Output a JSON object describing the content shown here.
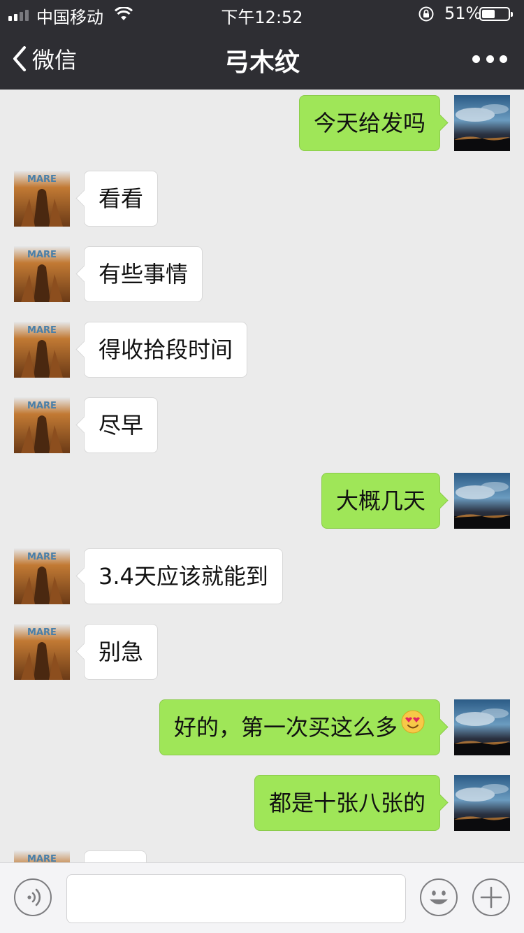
{
  "status_bar": {
    "carrier": "中国移动",
    "time": "下午12:52",
    "battery_percent_label": "51%",
    "battery_level": 0.51,
    "signal_bars": 2,
    "signal_total": 5
  },
  "nav": {
    "back_label": "微信",
    "title": "弓木纹"
  },
  "messages": [
    {
      "side": "right",
      "text": "今天给发吗"
    },
    {
      "side": "left",
      "text": "看看"
    },
    {
      "side": "left",
      "text": "有些事情"
    },
    {
      "side": "left",
      "text": "得收拾段时间"
    },
    {
      "side": "left",
      "text": "尽早"
    },
    {
      "side": "right",
      "text": "大概几天"
    },
    {
      "side": "left",
      "text": "3.4天应该就能到"
    },
    {
      "side": "left",
      "text": "别急"
    },
    {
      "side": "right",
      "text": "好的，第一次买这么多",
      "emoji": "heart-eyes-emoji"
    },
    {
      "side": "right",
      "text": "都是十张八张的"
    },
    {
      "side": "left",
      "text": ""
    }
  ],
  "input_bar": {
    "value": "",
    "voice_icon": "voice-icon",
    "emoji_icon": "smiley-icon",
    "plus_icon": "plus-icon"
  },
  "colors": {
    "header_bg": "#2e2e33",
    "chat_bg": "#ebebeb",
    "sent_bubble": "#9fe658",
    "received_bubble": "#ffffff"
  }
}
